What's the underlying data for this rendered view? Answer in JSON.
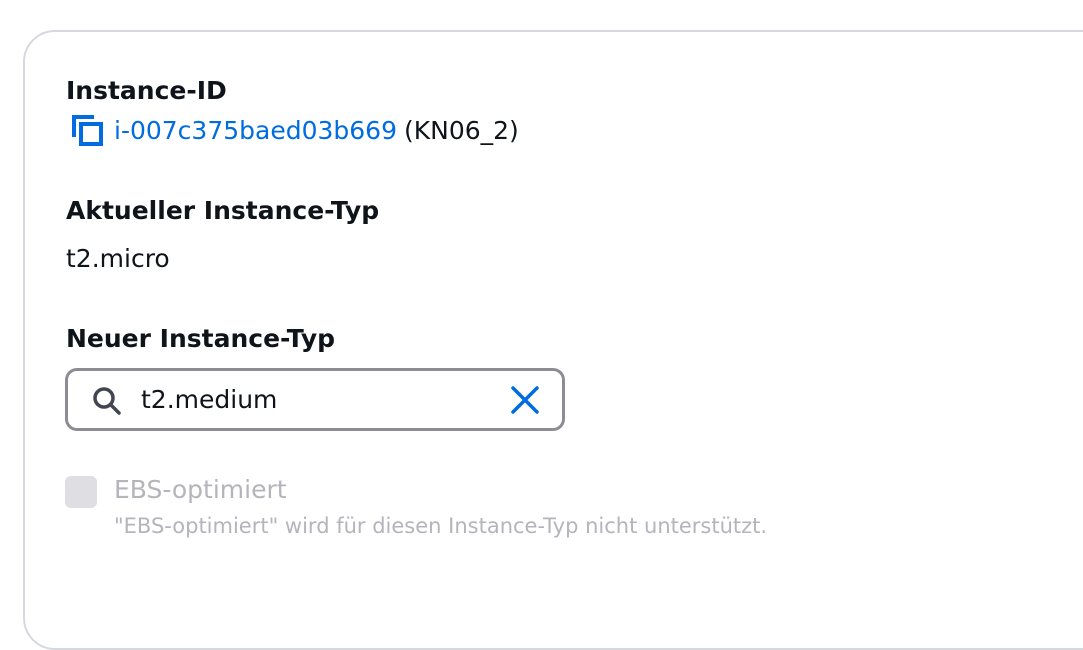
{
  "instance_id": {
    "label": "Instance-ID",
    "id_link": "i-007c375baed03b669",
    "name": "(KN06_2)"
  },
  "current_type": {
    "label": "Aktueller Instance-Typ",
    "value": "t2.micro"
  },
  "new_type": {
    "label": "Neuer Instance-Typ",
    "search_value": "t2.medium"
  },
  "ebs": {
    "label": "EBS-optimiert",
    "description": "\"EBS-optimiert\" wird für diesen Instance-Typ nicht unterstützt.",
    "checked": false,
    "disabled": true
  },
  "colors": {
    "link": "#006ce0",
    "text": "#0f141a",
    "disabled_text": "#b4b4bb",
    "border": "#8c8c94",
    "panel_border": "#d5d9de"
  },
  "icons": {
    "copy": "copy-icon",
    "search": "search-icon",
    "clear": "close-icon"
  }
}
